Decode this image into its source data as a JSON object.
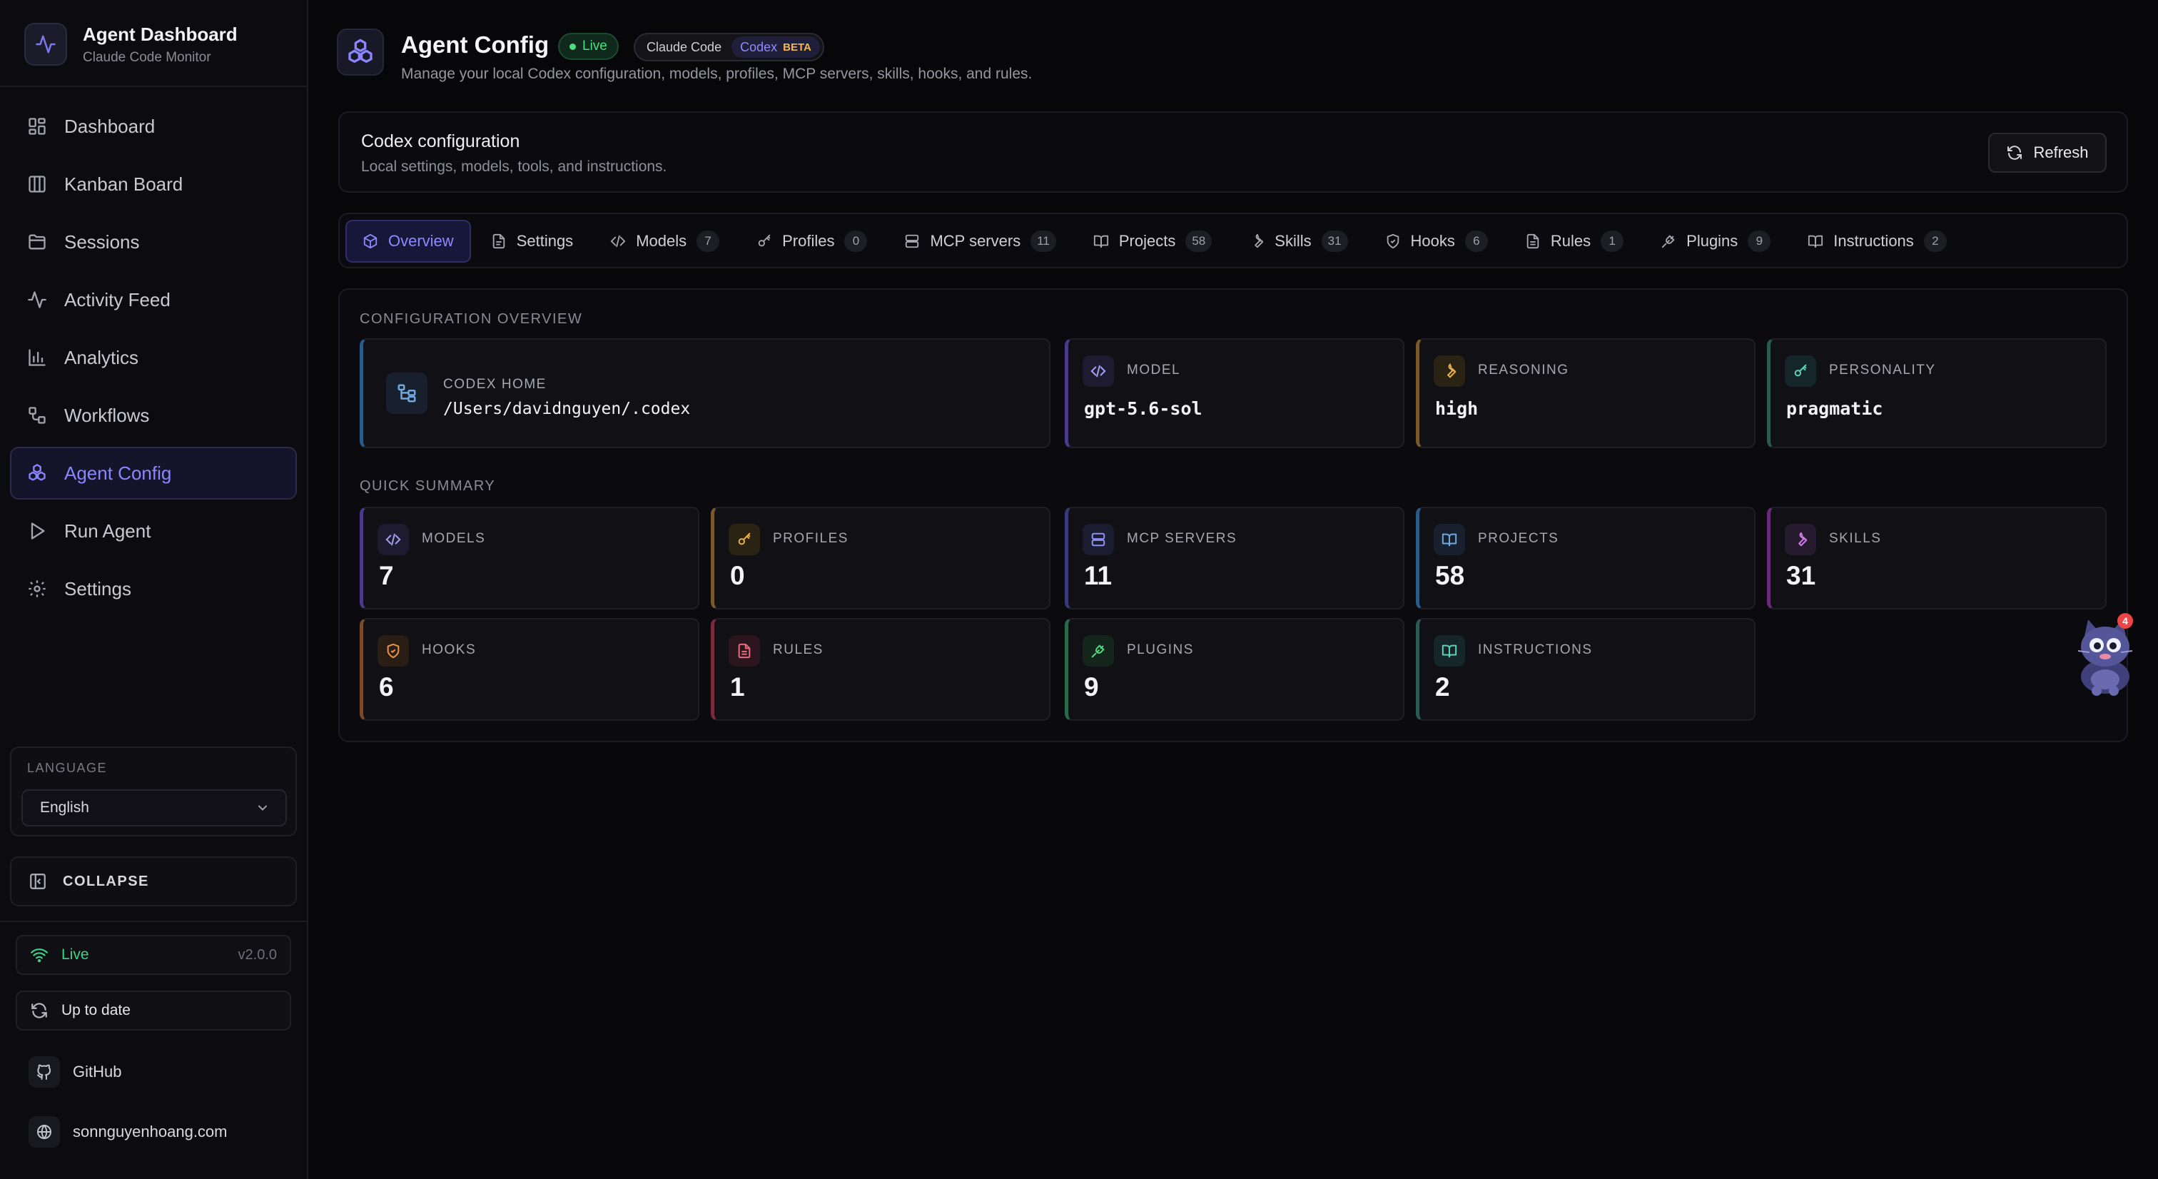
{
  "brand": {
    "title": "Agent Dashboard",
    "subtitle": "Claude Code Monitor"
  },
  "nav": [
    {
      "label": "Dashboard",
      "icon": "dashboard-icon"
    },
    {
      "label": "Kanban Board",
      "icon": "kanban-icon"
    },
    {
      "label": "Sessions",
      "icon": "folder-icon"
    },
    {
      "label": "Activity Feed",
      "icon": "activity-icon"
    },
    {
      "label": "Analytics",
      "icon": "bar-chart-icon"
    },
    {
      "label": "Workflows",
      "icon": "workflow-icon"
    },
    {
      "label": "Agent Config",
      "icon": "boxes-icon",
      "active": true
    },
    {
      "label": "Run Agent",
      "icon": "play-icon"
    },
    {
      "label": "Settings",
      "icon": "gear-icon"
    }
  ],
  "language": {
    "label": "LANGUAGE",
    "selected": "English"
  },
  "collapse_label": "COLLAPSE",
  "status": {
    "live_label": "Live",
    "version": "v2.0.0",
    "update_label": "Up to date"
  },
  "links": {
    "github": "GitHub",
    "website": "sonnguyenhoang.com"
  },
  "header": {
    "title": "Agent Config",
    "live_badge": "Live",
    "switch_claude": "Claude Code",
    "switch_codex": "Codex",
    "beta_badge": "BETA",
    "subtitle": "Manage your local Codex configuration, models, profiles, MCP servers, skills, hooks, and rules."
  },
  "config_card": {
    "title": "Codex configuration",
    "subtitle": "Local settings, models, tools, and instructions.",
    "refresh_label": "Refresh"
  },
  "tabs": [
    {
      "label": "Overview",
      "icon": "cube-icon",
      "active": true
    },
    {
      "label": "Settings",
      "icon": "file-icon"
    },
    {
      "label": "Models",
      "icon": "code-icon",
      "count": "7"
    },
    {
      "label": "Profiles",
      "icon": "key-icon",
      "count": "0"
    },
    {
      "label": "MCP servers",
      "icon": "server-icon",
      "count": "11"
    },
    {
      "label": "Projects",
      "icon": "book-icon",
      "count": "58"
    },
    {
      "label": "Skills",
      "icon": "wrench-icon",
      "count": "31"
    },
    {
      "label": "Hooks",
      "icon": "shield-icon",
      "count": "6"
    },
    {
      "label": "Rules",
      "icon": "file-text-icon",
      "count": "1"
    },
    {
      "label": "Plugins",
      "icon": "plug-icon",
      "count": "9"
    },
    {
      "label": "Instructions",
      "icon": "book-open-icon",
      "count": "2"
    }
  ],
  "overview": {
    "section_label": "CONFIGURATION OVERVIEW",
    "codex_home": {
      "label": "CODEX HOME",
      "value": "/Users/davidnguyen/.codex"
    },
    "model": {
      "label": "MODEL",
      "value": "gpt-5.6-sol"
    },
    "reasoning": {
      "label": "REASONING",
      "value": "high"
    },
    "personality": {
      "label": "PERSONALITY",
      "value": "pragmatic"
    }
  },
  "summary": {
    "section_label": "QUICK SUMMARY",
    "items": [
      {
        "label": "MODELS",
        "value": "7"
      },
      {
        "label": "PROFILES",
        "value": "0"
      },
      {
        "label": "MCP SERVERS",
        "value": "11"
      },
      {
        "label": "PROJECTS",
        "value": "58"
      },
      {
        "label": "SKILLS",
        "value": "31"
      },
      {
        "label": "HOOKS",
        "value": "6"
      },
      {
        "label": "RULES",
        "value": "1"
      },
      {
        "label": "PLUGINS",
        "value": "9"
      },
      {
        "label": "INSTRUCTIONS",
        "value": "2"
      }
    ]
  },
  "mascot": {
    "badge_count": "4"
  },
  "colors": {
    "accent": "#8a86ff",
    "live_green": "#4ade80",
    "beta_amber": "#f5b74a",
    "background": "#07070a"
  }
}
